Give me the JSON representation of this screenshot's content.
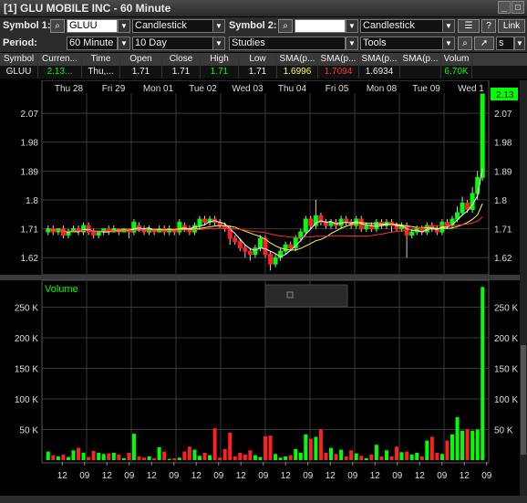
{
  "window": {
    "title": "[1] GLU MOBILE INC - 60 Minute",
    "minimize_icon": "minimize-icon",
    "restore_icon": "restore-icon"
  },
  "toolbar": {
    "symbol1_label": "Symbol 1:",
    "symbol1_value": "GLUU",
    "chart_type": "Candlestick",
    "symbol2_label": "Symbol 2:",
    "symbol2_value": "",
    "chart_type2": "Candlestick",
    "help_label": "?",
    "link_label": "Link",
    "period_label": "Period:",
    "period_value": "60 Minute",
    "range_value": "10 Day",
    "studies_value": "Studies",
    "tools_value": "Tools",
    "zoom_value": "s"
  },
  "quote_table": {
    "headers": [
      "Symbol",
      "Curren...",
      "Time",
      "Open",
      "Close",
      "High",
      "Low",
      "SMA(p...",
      "SMA(p...",
      "SMA(p...",
      "SMA(p...",
      "Volum"
    ],
    "row": [
      "GLUU",
      "2.13...",
      "Thu,...",
      "1.71",
      "1.71",
      "1.71",
      "1.71",
      "1.6996",
      "1.7094",
      "1.6934",
      "",
      "6.70K"
    ]
  },
  "chart_data": {
    "type": "candlestick",
    "x_top_labels": [
      "Thu 28",
      "Fri 29",
      "Mon 01",
      "Tue 02",
      "Wed 03",
      "Thu 04",
      "Fri 05",
      "Mon 08",
      "Tue 09",
      "Wed 1"
    ],
    "x_bottom_labels": [
      "12",
      "09",
      "12",
      "09",
      "12",
      "09",
      "12",
      "09",
      "12",
      "09",
      "12",
      "09",
      "12",
      "09",
      "12",
      "09",
      "12",
      "09",
      "12",
      "09"
    ],
    "price_ticks": [
      2.07,
      1.98,
      1.89,
      1.8,
      1.71,
      1.62
    ],
    "price_range": [
      1.575,
      2.13
    ],
    "last_price_label": "2.13",
    "volume_label": "Volume",
    "volume_ticks": [
      "250 K",
      "200 K",
      "150 K",
      "100 K",
      "50 K"
    ],
    "volume_tick_values": [
      250000,
      200000,
      150000,
      100000,
      50000
    ],
    "volume_range": [
      0,
      285000
    ],
    "candles": [
      {
        "o": 1.7,
        "c": 1.71,
        "h": 1.72,
        "l": 1.69,
        "v": 14000
      },
      {
        "o": 1.71,
        "c": 1.7,
        "h": 1.72,
        "l": 1.69,
        "v": 8000
      },
      {
        "o": 1.7,
        "c": 1.71,
        "h": 1.71,
        "l": 1.69,
        "v": 6000
      },
      {
        "o": 1.71,
        "c": 1.69,
        "h": 1.72,
        "l": 1.68,
        "v": 9000
      },
      {
        "o": 1.69,
        "c": 1.7,
        "h": 1.71,
        "l": 1.68,
        "v": 5000
      },
      {
        "o": 1.7,
        "c": 1.71,
        "h": 1.72,
        "l": 1.7,
        "v": 16000
      },
      {
        "o": 1.71,
        "c": 1.7,
        "h": 1.72,
        "l": 1.69,
        "v": 20000
      },
      {
        "o": 1.7,
        "c": 1.72,
        "h": 1.73,
        "l": 1.69,
        "v": 12000
      },
      {
        "o": 1.72,
        "c": 1.7,
        "h": 1.73,
        "l": 1.69,
        "v": 5000
      },
      {
        "o": 1.7,
        "c": 1.69,
        "h": 1.71,
        "l": 1.68,
        "v": 15000
      },
      {
        "o": 1.69,
        "c": 1.7,
        "h": 1.7,
        "l": 1.68,
        "v": 12000
      },
      {
        "o": 1.7,
        "c": 1.71,
        "h": 1.71,
        "l": 1.69,
        "v": 10000
      },
      {
        "o": 1.71,
        "c": 1.7,
        "h": 1.72,
        "l": 1.69,
        "v": 11000
      },
      {
        "o": 1.7,
        "c": 1.71,
        "h": 1.72,
        "l": 1.7,
        "v": 12000
      },
      {
        "o": 1.71,
        "c": 1.7,
        "h": 1.71,
        "l": 1.69,
        "v": 9000
      },
      {
        "o": 1.7,
        "c": 1.71,
        "h": 1.71,
        "l": 1.7,
        "v": 3000
      },
      {
        "o": 1.71,
        "c": 1.7,
        "h": 1.71,
        "l": 1.68,
        "v": 12000
      },
      {
        "o": 1.7,
        "c": 1.73,
        "h": 1.74,
        "l": 1.69,
        "v": 43000
      },
      {
        "o": 1.72,
        "c": 1.71,
        "h": 1.73,
        "l": 1.7,
        "v": 6000
      },
      {
        "o": 1.71,
        "c": 1.7,
        "h": 1.72,
        "l": 1.69,
        "v": 4000
      },
      {
        "o": 1.7,
        "c": 1.71,
        "h": 1.72,
        "l": 1.69,
        "v": 6000
      },
      {
        "o": 1.71,
        "c": 1.7,
        "h": 1.71,
        "l": 1.69,
        "v": 3000
      },
      {
        "o": 1.7,
        "c": 1.71,
        "h": 1.72,
        "l": 1.7,
        "v": 21000
      },
      {
        "o": 1.71,
        "c": 1.7,
        "h": 1.72,
        "l": 1.69,
        "v": 14000
      },
      {
        "o": 1.7,
        "c": 1.71,
        "h": 1.72,
        "l": 1.69,
        "v": 2000
      },
      {
        "o": 1.71,
        "c": 1.7,
        "h": 1.71,
        "l": 1.69,
        "v": 3000
      },
      {
        "o": 1.7,
        "c": 1.73,
        "h": 1.74,
        "l": 1.69,
        "v": 4000
      },
      {
        "o": 1.72,
        "c": 1.71,
        "h": 1.73,
        "l": 1.7,
        "v": 14000
      },
      {
        "o": 1.71,
        "c": 1.7,
        "h": 1.72,
        "l": 1.69,
        "v": 22000
      },
      {
        "o": 1.7,
        "c": 1.72,
        "h": 1.73,
        "l": 1.69,
        "v": 17000
      },
      {
        "o": 1.72,
        "c": 1.74,
        "h": 1.75,
        "l": 1.71,
        "v": 7000
      },
      {
        "o": 1.74,
        "c": 1.73,
        "h": 1.75,
        "l": 1.72,
        "v": 12000
      },
      {
        "o": 1.73,
        "c": 1.74,
        "h": 1.75,
        "l": 1.72,
        "v": 8000
      },
      {
        "o": 1.74,
        "c": 1.73,
        "h": 1.75,
        "l": 1.72,
        "v": 52000
      },
      {
        "o": 1.73,
        "c": 1.72,
        "h": 1.74,
        "l": 1.71,
        "v": 4000
      },
      {
        "o": 1.72,
        "c": 1.71,
        "h": 1.73,
        "l": 1.7,
        "v": 18000
      },
      {
        "o": 1.71,
        "c": 1.68,
        "h": 1.72,
        "l": 1.66,
        "v": 45000
      },
      {
        "o": 1.68,
        "c": 1.67,
        "h": 1.69,
        "l": 1.66,
        "v": 6000
      },
      {
        "o": 1.67,
        "c": 1.65,
        "h": 1.68,
        "l": 1.64,
        "v": 12000
      },
      {
        "o": 1.65,
        "c": 1.64,
        "h": 1.66,
        "l": 1.62,
        "v": 9000
      },
      {
        "o": 1.64,
        "c": 1.63,
        "h": 1.65,
        "l": 1.61,
        "v": 16000
      },
      {
        "o": 1.63,
        "c": 1.65,
        "h": 1.66,
        "l": 1.62,
        "v": 8000
      },
      {
        "o": 1.65,
        "c": 1.68,
        "h": 1.69,
        "l": 1.64,
        "v": 5000
      },
      {
        "o": 1.68,
        "c": 1.63,
        "h": 1.69,
        "l": 1.62,
        "v": 39000
      },
      {
        "o": 1.63,
        "c": 1.6,
        "h": 1.64,
        "l": 1.58,
        "v": 40000
      },
      {
        "o": 1.6,
        "c": 1.62,
        "h": 1.63,
        "l": 1.59,
        "v": 10000
      },
      {
        "o": 1.62,
        "c": 1.64,
        "h": 1.65,
        "l": 1.61,
        "v": 4000
      },
      {
        "o": 1.64,
        "c": 1.66,
        "h": 1.67,
        "l": 1.63,
        "v": 6000
      },
      {
        "o": 1.66,
        "c": 1.65,
        "h": 1.67,
        "l": 1.64,
        "v": 8000
      },
      {
        "o": 1.65,
        "c": 1.68,
        "h": 1.69,
        "l": 1.64,
        "v": 18000
      },
      {
        "o": 1.68,
        "c": 1.7,
        "h": 1.71,
        "l": 1.67,
        "v": 12000
      },
      {
        "o": 1.7,
        "c": 1.74,
        "h": 1.75,
        "l": 1.69,
        "v": 42000
      },
      {
        "o": 1.74,
        "c": 1.72,
        "h": 1.75,
        "l": 1.71,
        "v": 35000
      },
      {
        "o": 1.72,
        "c": 1.75,
        "h": 1.8,
        "l": 1.71,
        "v": 38000
      },
      {
        "o": 1.75,
        "c": 1.73,
        "h": 1.76,
        "l": 1.72,
        "v": 50000
      },
      {
        "o": 1.73,
        "c": 1.72,
        "h": 1.74,
        "l": 1.71,
        "v": 12000
      },
      {
        "o": 1.72,
        "c": 1.73,
        "h": 1.74,
        "l": 1.71,
        "v": 20000
      },
      {
        "o": 1.73,
        "c": 1.72,
        "h": 1.74,
        "l": 1.71,
        "v": 10000
      },
      {
        "o": 1.72,
        "c": 1.74,
        "h": 1.75,
        "l": 1.71,
        "v": 17000
      },
      {
        "o": 1.74,
        "c": 1.73,
        "h": 1.75,
        "l": 1.72,
        "v": 6000
      },
      {
        "o": 1.73,
        "c": 1.72,
        "h": 1.74,
        "l": 1.71,
        "v": 16000
      },
      {
        "o": 1.72,
        "c": 1.74,
        "h": 1.75,
        "l": 1.71,
        "v": 11000
      },
      {
        "o": 1.74,
        "c": 1.71,
        "h": 1.75,
        "l": 1.7,
        "v": 7000
      },
      {
        "o": 1.71,
        "c": 1.72,
        "h": 1.73,
        "l": 1.7,
        "v": 3000
      },
      {
        "o": 1.72,
        "c": 1.71,
        "h": 1.73,
        "l": 1.7,
        "v": 9000
      },
      {
        "o": 1.71,
        "c": 1.73,
        "h": 1.74,
        "l": 1.7,
        "v": 25000
      },
      {
        "o": 1.73,
        "c": 1.72,
        "h": 1.74,
        "l": 1.71,
        "v": 6000
      },
      {
        "o": 1.72,
        "c": 1.73,
        "h": 1.74,
        "l": 1.71,
        "v": 16000
      },
      {
        "o": 1.73,
        "c": 1.72,
        "h": 1.74,
        "l": 1.7,
        "v": 6000
      },
      {
        "o": 1.72,
        "c": 1.71,
        "h": 1.73,
        "l": 1.7,
        "v": 22000
      },
      {
        "o": 1.71,
        "c": 1.72,
        "h": 1.73,
        "l": 1.7,
        "v": 13000
      },
      {
        "o": 1.72,
        "c": 1.69,
        "h": 1.73,
        "l": 1.62,
        "v": 14000
      },
      {
        "o": 1.69,
        "c": 1.7,
        "h": 1.71,
        "l": 1.68,
        "v": 9000
      },
      {
        "o": 1.7,
        "c": 1.71,
        "h": 1.72,
        "l": 1.69,
        "v": 12000
      },
      {
        "o": 1.71,
        "c": 1.7,
        "h": 1.72,
        "l": 1.69,
        "v": 6000
      },
      {
        "o": 1.7,
        "c": 1.72,
        "h": 1.73,
        "l": 1.69,
        "v": 32000
      },
      {
        "o": 1.72,
        "c": 1.71,
        "h": 1.73,
        "l": 1.7,
        "v": 38000
      },
      {
        "o": 1.71,
        "c": 1.7,
        "h": 1.72,
        "l": 1.69,
        "v": 12000
      },
      {
        "o": 1.7,
        "c": 1.73,
        "h": 1.74,
        "l": 1.69,
        "v": 10000
      },
      {
        "o": 1.73,
        "c": 1.72,
        "h": 1.74,
        "l": 1.71,
        "v": 32000
      },
      {
        "o": 1.72,
        "c": 1.74,
        "h": 1.75,
        "l": 1.71,
        "v": 42000
      },
      {
        "o": 1.74,
        "c": 1.76,
        "h": 1.78,
        "l": 1.73,
        "v": 70000
      },
      {
        "o": 1.76,
        "c": 1.79,
        "h": 1.81,
        "l": 1.75,
        "v": 48000
      },
      {
        "o": 1.79,
        "c": 1.77,
        "h": 1.8,
        "l": 1.76,
        "v": 50000
      },
      {
        "o": 1.77,
        "c": 1.82,
        "h": 1.84,
        "l": 1.76,
        "v": 48000
      },
      {
        "o": 1.82,
        "c": 1.87,
        "h": 1.89,
        "l": 1.8,
        "v": 50000
      },
      {
        "o": 1.87,
        "c": 2.13,
        "h": 2.13,
        "l": 1.86,
        "v": 283000
      }
    ]
  },
  "colors": {
    "up": "#00ff00",
    "down": "#ff2020",
    "grid": "#3a3a3a",
    "sma_white": "#ffffff",
    "sma_yellow": "#ffff40",
    "sma_red": "#ff3030",
    "last_price_bg": "#00ff00"
  }
}
